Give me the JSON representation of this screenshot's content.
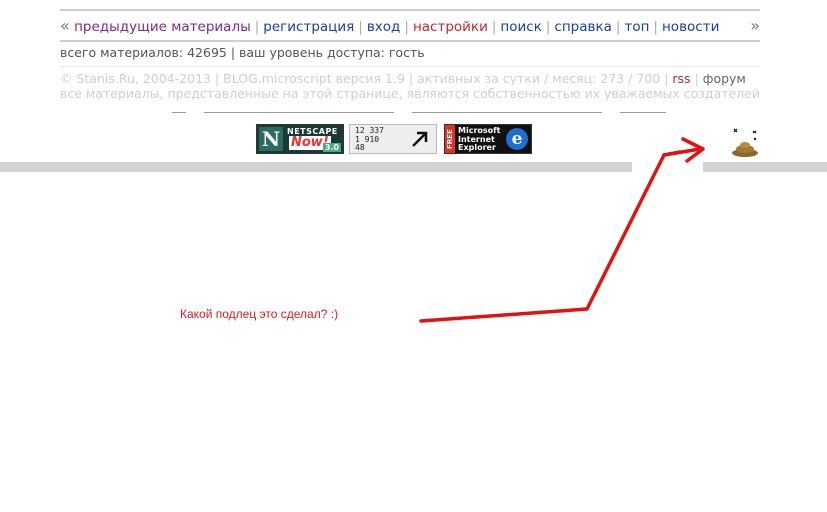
{
  "nav": {
    "prev_arrow": "«",
    "next_arrow": "»",
    "items": [
      {
        "label": "предыдущие материалы",
        "color": "#7b2a8a"
      },
      {
        "label": "регистрация",
        "color": "#1a3fa0"
      },
      {
        "label": "вход",
        "color": "#1a3fa0"
      },
      {
        "label": "настройки",
        "color": "#c2272d"
      },
      {
        "label": "поиск",
        "color": "#1a3fa0"
      },
      {
        "label": "справка",
        "color": "#1a3fa0"
      },
      {
        "label": "топ",
        "color": "#1a3fa0"
      },
      {
        "label": "новости",
        "color": "#1a3fa0"
      }
    ],
    "separator": "|"
  },
  "stats": {
    "text": "всего материалов: 42695 | ваш уровень доступа: гость"
  },
  "footer": {
    "line1_text": "© Stanis.Ru, 2004-2013 | BLOG.microscript версия 1.9 | активных за сутки / месяц: 273 / 700 |",
    "rss_label": "rss",
    "separator": "|",
    "forum_label": "форум",
    "line2_text": "все материалы, представленные на этой странице, являются собственностью их уважаемых создателей"
  },
  "badges": {
    "netscape": {
      "title": "NETSCAPE",
      "now": "Now!",
      "version": "3.0",
      "letter": "N"
    },
    "counter": {
      "lines": [
        "12 337",
        "1 910",
        "48"
      ]
    },
    "ie": {
      "free": "FREE",
      "line1": "Microsoft",
      "line2": "Internet",
      "line3": "Explorer",
      "logo": "e"
    }
  },
  "message": "Какой подлец это сделал? :)",
  "colors": {
    "accent_red": "#d21f1f",
    "link_blue": "#1a3fa0",
    "link_purple": "#7b2a8a",
    "bar_gray": "#d2d2d2"
  }
}
